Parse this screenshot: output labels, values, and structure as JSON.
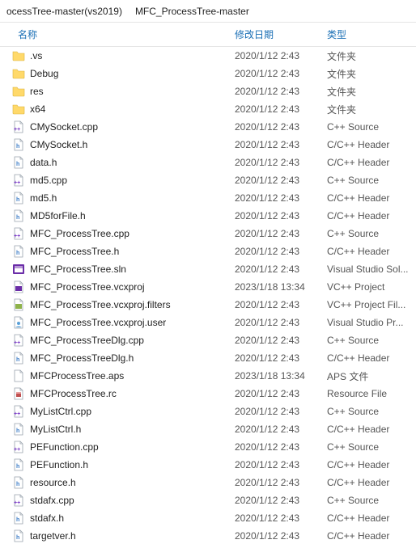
{
  "breadcrumb": {
    "crumbs": [
      "ocessTree-master(vs2019)",
      "MFC_ProcessTree-master"
    ]
  },
  "columns": {
    "name": "名称",
    "date": "修改日期",
    "type": "类型"
  },
  "files": [
    {
      "icon": "folder",
      "name": ".vs",
      "date": "2020/1/12 2:43",
      "type": "文件夹"
    },
    {
      "icon": "folder",
      "name": "Debug",
      "date": "2020/1/12 2:43",
      "type": "文件夹"
    },
    {
      "icon": "folder",
      "name": "res",
      "date": "2020/1/12 2:43",
      "type": "文件夹"
    },
    {
      "icon": "folder",
      "name": "x64",
      "date": "2020/1/12 2:43",
      "type": "文件夹"
    },
    {
      "icon": "cpp",
      "name": "CMySocket.cpp",
      "date": "2020/1/12 2:43",
      "type": "C++ Source"
    },
    {
      "icon": "h",
      "name": "CMySocket.h",
      "date": "2020/1/12 2:43",
      "type": "C/C++ Header"
    },
    {
      "icon": "h",
      "name": "data.h",
      "date": "2020/1/12 2:43",
      "type": "C/C++ Header"
    },
    {
      "icon": "cpp",
      "name": "md5.cpp",
      "date": "2020/1/12 2:43",
      "type": "C++ Source"
    },
    {
      "icon": "h",
      "name": "md5.h",
      "date": "2020/1/12 2:43",
      "type": "C/C++ Header"
    },
    {
      "icon": "h",
      "name": "MD5forFile.h",
      "date": "2020/1/12 2:43",
      "type": "C/C++ Header"
    },
    {
      "icon": "cpp",
      "name": "MFC_ProcessTree.cpp",
      "date": "2020/1/12 2:43",
      "type": "C++ Source"
    },
    {
      "icon": "h",
      "name": "MFC_ProcessTree.h",
      "date": "2020/1/12 2:43",
      "type": "C/C++ Header"
    },
    {
      "icon": "sln",
      "name": "MFC_ProcessTree.sln",
      "date": "2020/1/12 2:43",
      "type": "Visual Studio Sol..."
    },
    {
      "icon": "vcxproj",
      "name": "MFC_ProcessTree.vcxproj",
      "date": "2023/1/18 13:34",
      "type": "VC++ Project"
    },
    {
      "icon": "vcxfilt",
      "name": "MFC_ProcessTree.vcxproj.filters",
      "date": "2020/1/12 2:43",
      "type": "VC++ Project Fil..."
    },
    {
      "icon": "vcxuser",
      "name": "MFC_ProcessTree.vcxproj.user",
      "date": "2020/1/12 2:43",
      "type": "Visual Studio Pr..."
    },
    {
      "icon": "cpp",
      "name": "MFC_ProcessTreeDlg.cpp",
      "date": "2020/1/12 2:43",
      "type": "C++ Source"
    },
    {
      "icon": "h",
      "name": "MFC_ProcessTreeDlg.h",
      "date": "2020/1/12 2:43",
      "type": "C/C++ Header"
    },
    {
      "icon": "generic",
      "name": "MFCProcessTree.aps",
      "date": "2023/1/18 13:34",
      "type": "APS 文件"
    },
    {
      "icon": "rc",
      "name": "MFCProcessTree.rc",
      "date": "2020/1/12 2:43",
      "type": "Resource File"
    },
    {
      "icon": "cpp",
      "name": "MyListCtrl.cpp",
      "date": "2020/1/12 2:43",
      "type": "C++ Source"
    },
    {
      "icon": "h",
      "name": "MyListCtrl.h",
      "date": "2020/1/12 2:43",
      "type": "C/C++ Header"
    },
    {
      "icon": "cpp",
      "name": "PEFunction.cpp",
      "date": "2020/1/12 2:43",
      "type": "C++ Source"
    },
    {
      "icon": "h",
      "name": "PEFunction.h",
      "date": "2020/1/12 2:43",
      "type": "C/C++ Header"
    },
    {
      "icon": "h",
      "name": "resource.h",
      "date": "2020/1/12 2:43",
      "type": "C/C++ Header"
    },
    {
      "icon": "cpp",
      "name": "stdafx.cpp",
      "date": "2020/1/12 2:43",
      "type": "C++ Source"
    },
    {
      "icon": "h",
      "name": "stdafx.h",
      "date": "2020/1/12 2:43",
      "type": "C/C++ Header"
    },
    {
      "icon": "h",
      "name": "targetver.h",
      "date": "2020/1/12 2:43",
      "type": "C/C++ Header"
    }
  ]
}
